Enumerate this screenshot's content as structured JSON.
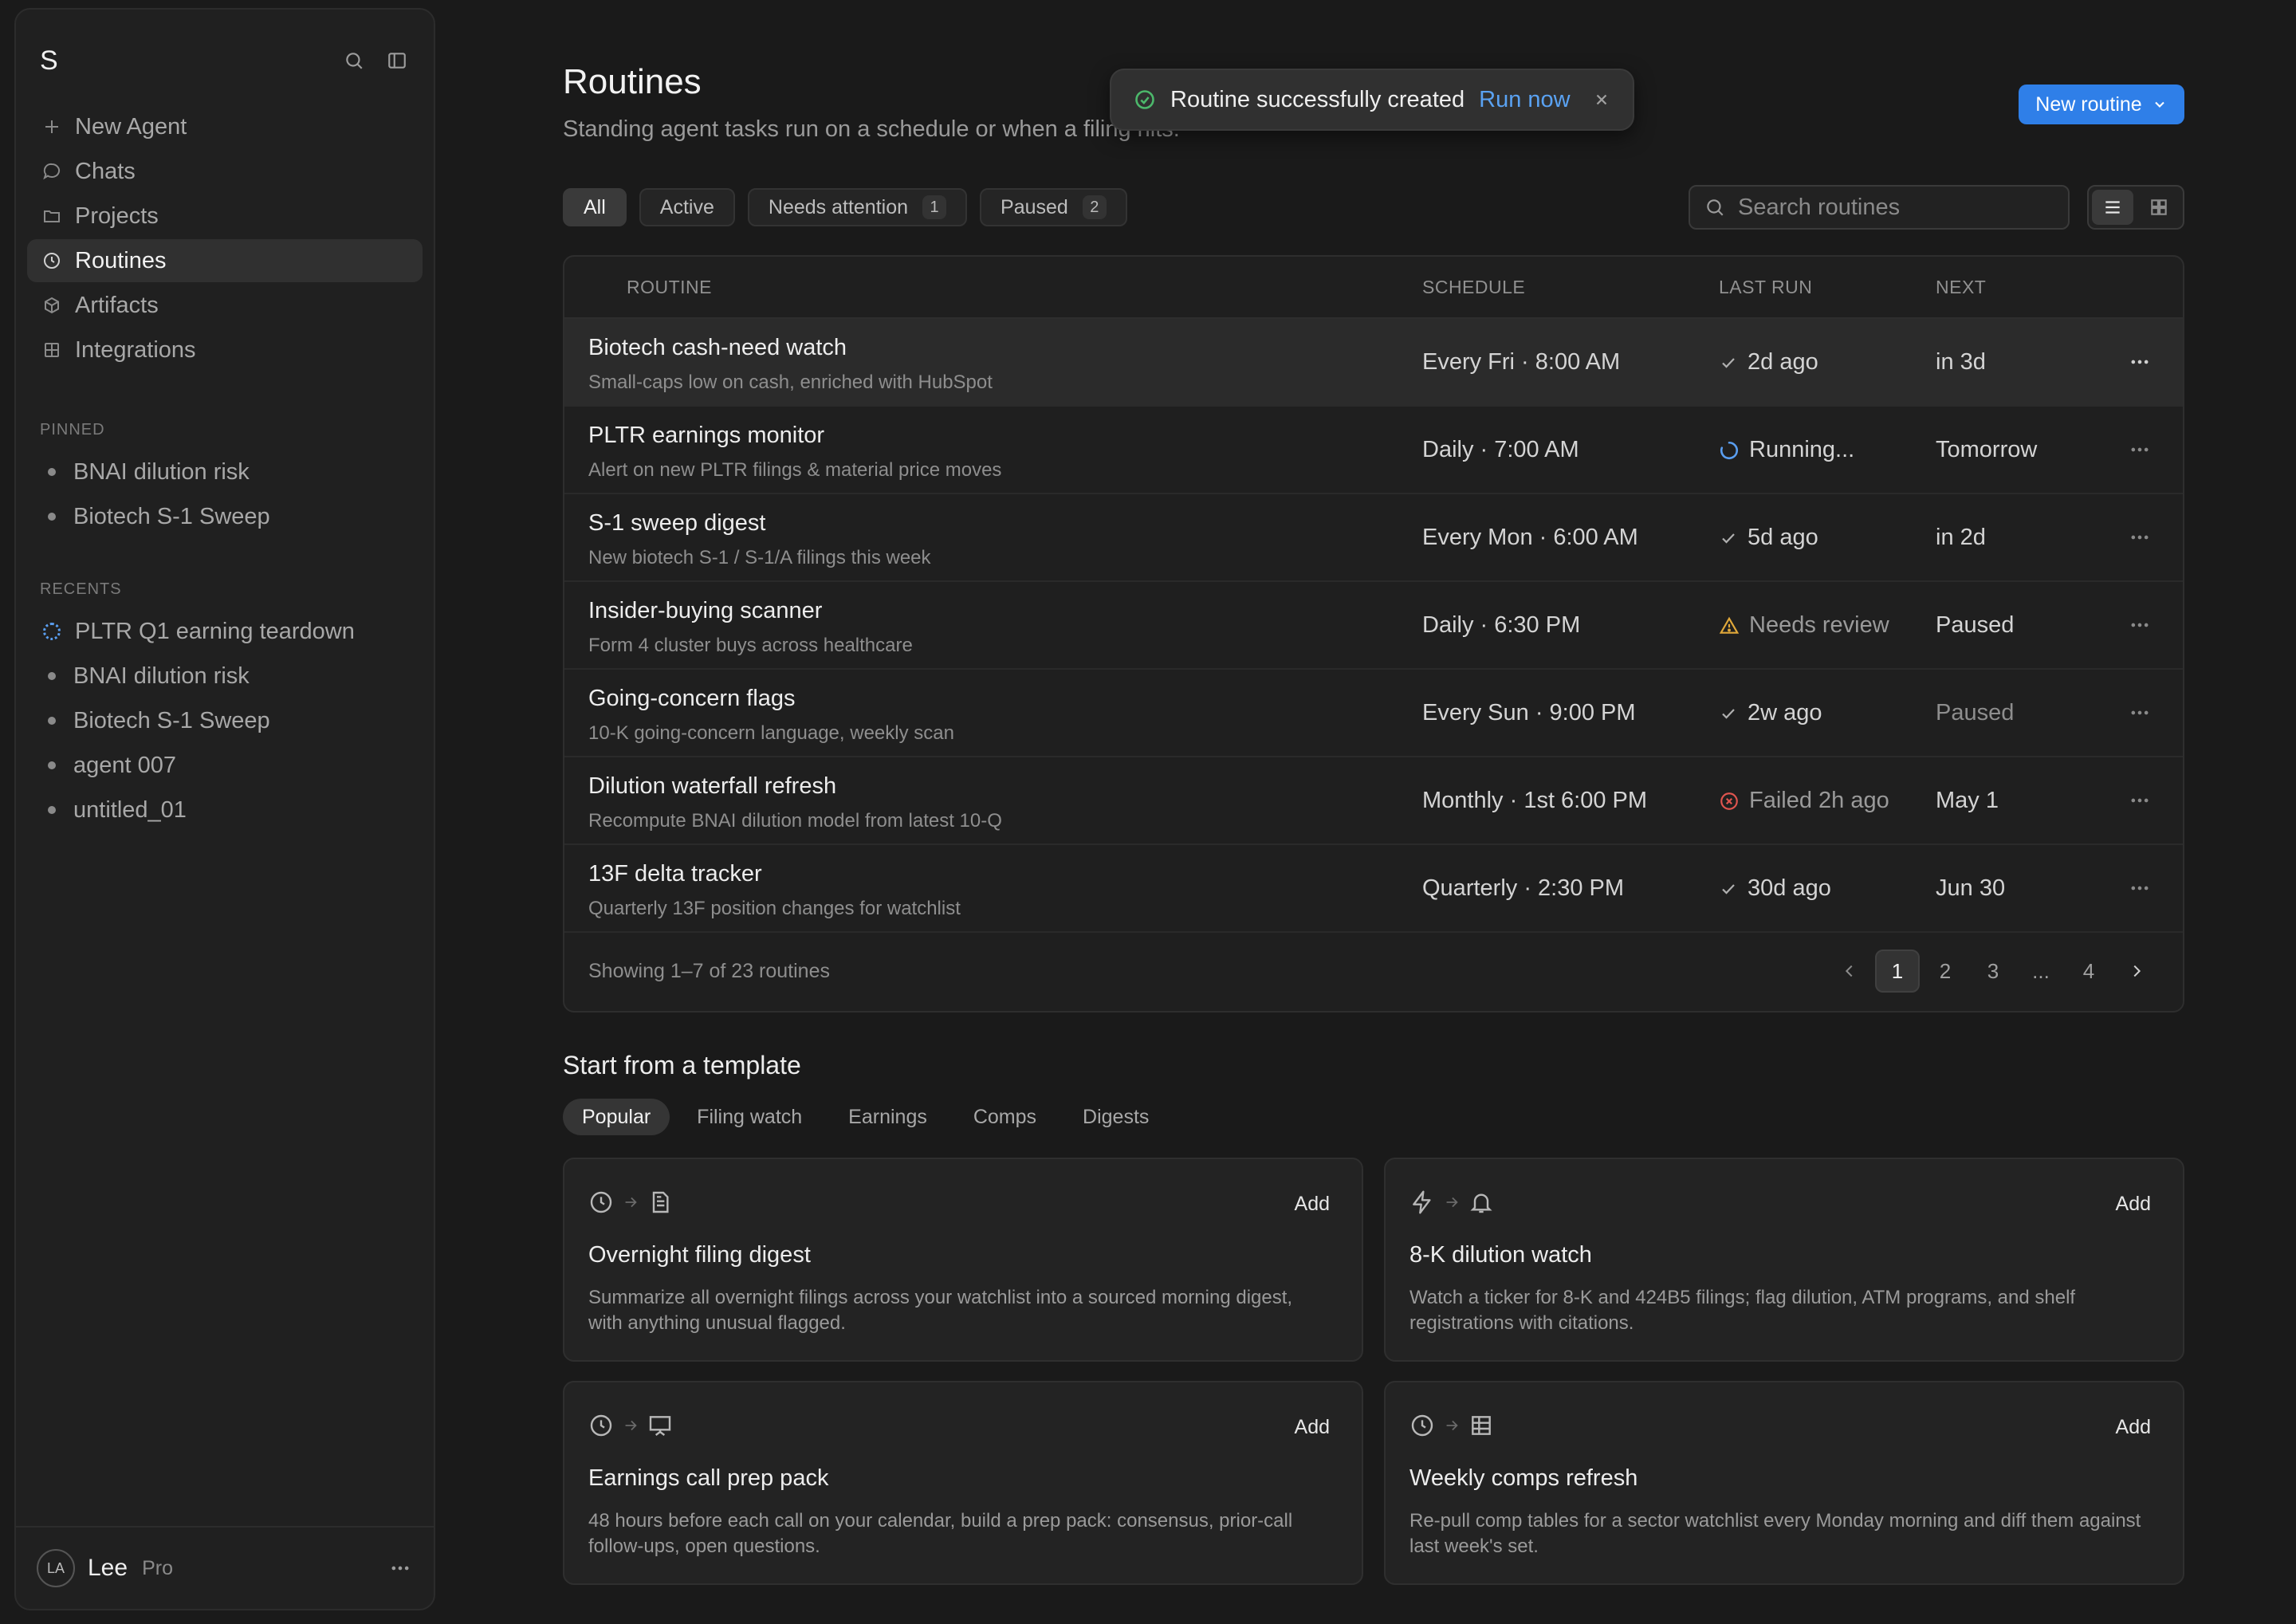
{
  "sidebar": {
    "logo": "S",
    "nav": [
      {
        "label": "New Agent",
        "icon": "plus-icon"
      },
      {
        "label": "Chats",
        "icon": "chat-icon"
      },
      {
        "label": "Projects",
        "icon": "folder-icon"
      },
      {
        "label": "Routines",
        "icon": "clock-icon",
        "active": true
      },
      {
        "label": "Artifacts",
        "icon": "cube-icon"
      },
      {
        "label": "Integrations",
        "icon": "grid-icon"
      }
    ],
    "pinned_label": "PINNED",
    "pinned": [
      "BNAI dilution risk",
      "Biotech S-1 Sweep"
    ],
    "recents_label": "RECENTS",
    "recents": [
      "PLTR Q1 earning teardown",
      "BNAI dilution risk",
      "Biotech S-1 Sweep",
      "agent 007",
      "untitled_01"
    ],
    "user": {
      "initials": "LA",
      "name": "Lee",
      "plan": "Pro"
    }
  },
  "header": {
    "title": "Routines",
    "subtitle": "Standing agent tasks run on a schedule or when a filing hits.",
    "new_button": "New routine"
  },
  "toast": {
    "message": "Routine successfully created",
    "action": "Run now"
  },
  "filters": [
    {
      "label": "All",
      "active": true
    },
    {
      "label": "Active"
    },
    {
      "label": "Needs attention",
      "count": "1"
    },
    {
      "label": "Paused",
      "count": "2"
    }
  ],
  "search": {
    "placeholder": "Search routines"
  },
  "table": {
    "columns": {
      "routine": "ROUTINE",
      "schedule": "SCHEDULE",
      "last_run": "LAST RUN",
      "next": "NEXT"
    },
    "rows": [
      {
        "title": "Biotech cash-need watch",
        "desc": "Small-caps low on cash, enriched with HubSpot",
        "schedule": "Every Fri · 8:00 AM",
        "status": "success",
        "last_run": "2d ago",
        "next": "in 3d"
      },
      {
        "title": "PLTR earnings monitor",
        "desc": "Alert on new PLTR filings & material price moves",
        "schedule": "Daily · 7:00 AM",
        "status": "running",
        "last_run": "Running...",
        "next": "Tomorrow"
      },
      {
        "title": "S-1 sweep digest",
        "desc": "New biotech S-1 / S-1/A filings this week",
        "schedule": "Every Mon · 6:00 AM",
        "status": "success",
        "last_run": "5d ago",
        "next": "in 2d"
      },
      {
        "title": "Insider-buying scanner",
        "desc": "Form 4 cluster buys across healthcare",
        "schedule": "Daily · 6:30 PM",
        "status": "warning",
        "last_run": "Needs review",
        "next": "Paused"
      },
      {
        "title": "Going-concern flags",
        "desc": "10-K going-concern language, weekly scan",
        "schedule": "Every Sun · 9:00 PM",
        "status": "success",
        "last_run": "2w ago",
        "next": "Paused"
      },
      {
        "title": "Dilution waterfall refresh",
        "desc": "Recompute BNAI dilution model from latest 10-Q",
        "schedule": "Monthly · 1st 6:00 PM",
        "status": "failed",
        "last_run": "Failed 2h ago",
        "next": "May 1"
      },
      {
        "title": "13F delta tracker",
        "desc": "Quarterly 13F position changes for watchlist",
        "schedule": "Quarterly · 2:30 PM",
        "status": "success",
        "last_run": "30d ago",
        "next": "Jun 30"
      }
    ],
    "showing": "Showing 1–7 of 23 routines",
    "pages": [
      "1",
      "2",
      "3",
      "...",
      "4"
    ],
    "current_page": "1"
  },
  "templates": {
    "title": "Start from a template",
    "tabs": [
      "Popular",
      "Filing watch",
      "Earnings",
      "Comps",
      "Digests"
    ],
    "active_tab": "Popular",
    "add_label": "Add",
    "cards": [
      {
        "icons": [
          "clock-icon",
          "document-icon"
        ],
        "title": "Overnight filing digest",
        "desc": "Summarize all overnight filings across your watchlist into a sourced morning digest, with anything unusual flagged."
      },
      {
        "icons": [
          "lightning-icon",
          "bell-icon"
        ],
        "title": "8-K dilution watch",
        "desc": "Watch a ticker for 8-K and 424B5 filings; flag dilution, ATM programs, and shelf registrations with citations."
      },
      {
        "icons": [
          "clock-icon",
          "presentation-icon"
        ],
        "title": "Earnings call prep pack",
        "desc": "48 hours before each call on your calendar, build a prep pack: consensus, prior-call follow-ups, open questions."
      },
      {
        "icons": [
          "clock-icon",
          "table-icon"
        ],
        "title": "Weekly comps refresh",
        "desc": "Re-pull comp tables for a sector watchlist every Monday morning and diff them against last week's set."
      }
    ]
  },
  "colors": {
    "accent": "#2f7fe8",
    "success": "#4cb86b",
    "running": "#5a9ef0",
    "warning": "#e0a83a",
    "failed": "#e0554f"
  }
}
